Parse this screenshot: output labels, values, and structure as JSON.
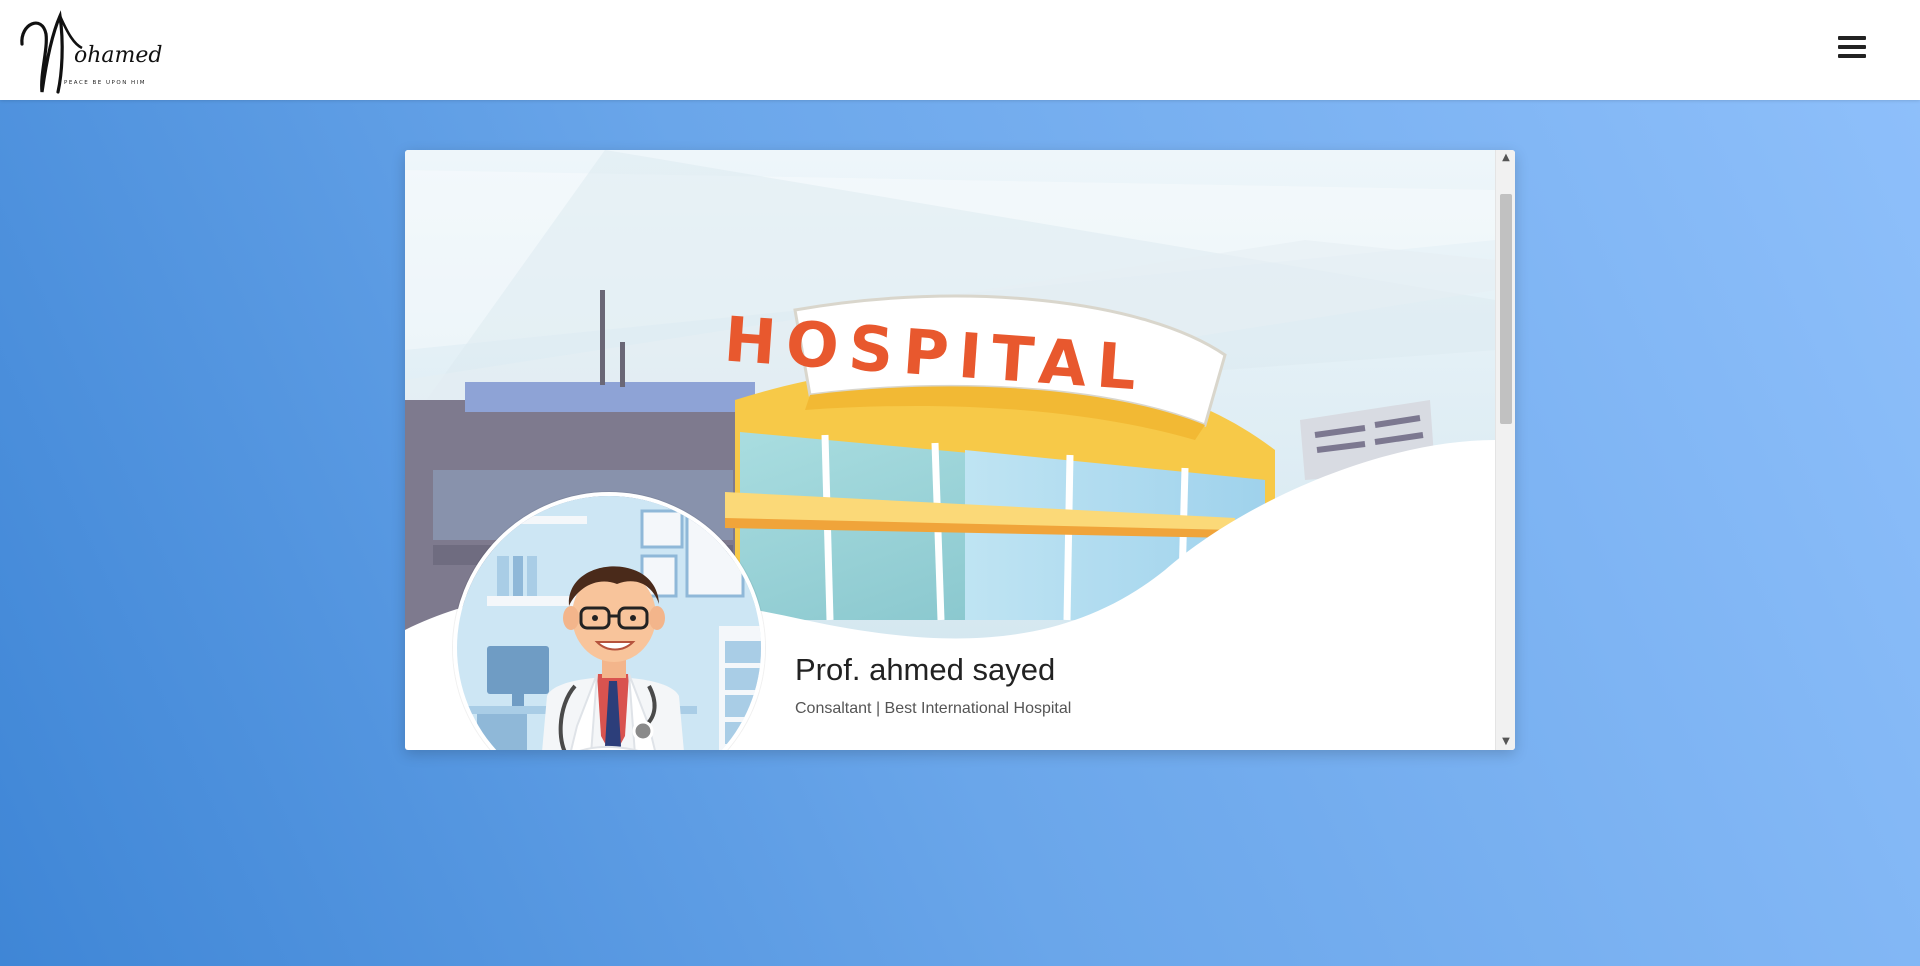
{
  "header": {
    "logo_text": "Mohamed",
    "logo_tagline": "PEACE BE UPON HIM",
    "menu_icon": "hamburger-menu-icon"
  },
  "profile": {
    "banner_sign": "HOSPITAL",
    "name": "Prof. ahmed sayed",
    "subtitle": "Consaltant | Best International Hospital"
  },
  "scrollbar": {
    "up_glyph": "▲",
    "down_glyph": "▼"
  },
  "colors": {
    "accent_sign_text": "#e8582e",
    "sign_yellow": "#f7c948",
    "background_start": "#3f86d6",
    "background_end": "#8fc0fb"
  }
}
